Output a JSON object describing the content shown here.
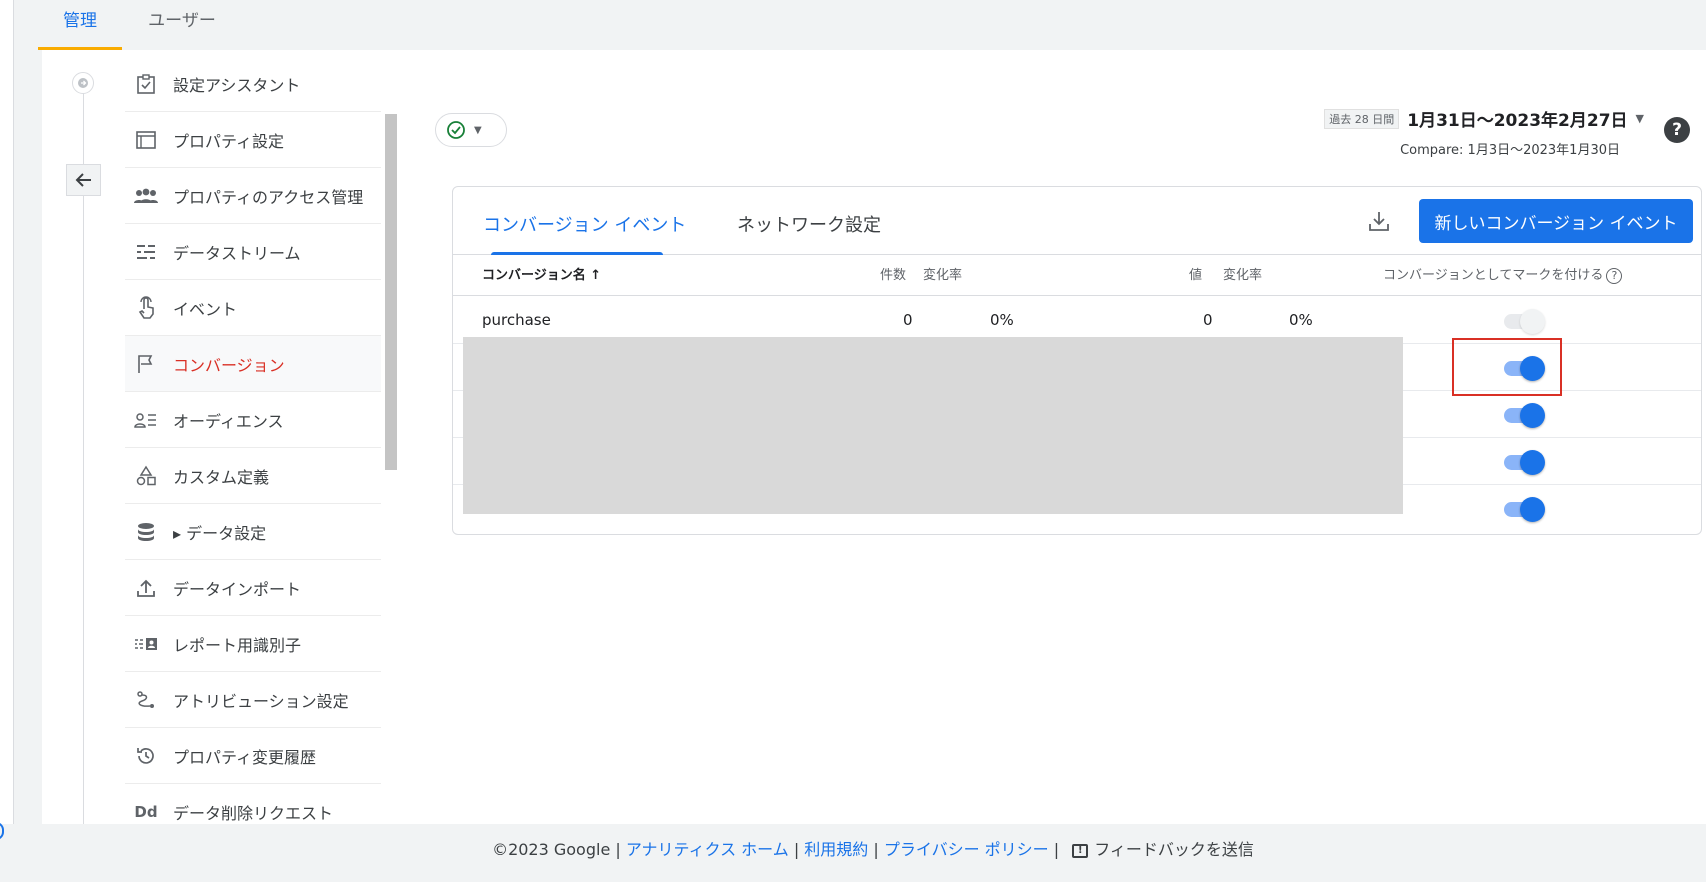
{
  "top_tabs": {
    "admin": "管理",
    "user": "ユーザー"
  },
  "sidebar": {
    "setup_assistant": "設定アシスタント",
    "items": [
      {
        "label": "プロパティ設定",
        "icon": "layout-icon"
      },
      {
        "label": "プロパティのアクセス管理",
        "icon": "people-icon"
      },
      {
        "label": "データストリーム",
        "icon": "streams-icon"
      },
      {
        "label": "イベント",
        "icon": "touch-icon"
      },
      {
        "label": "コンバージョン",
        "icon": "flag-icon",
        "active": true
      },
      {
        "label": "オーディエンス",
        "icon": "audience-icon"
      },
      {
        "label": "カスタム定義",
        "icon": "shapes-icon"
      },
      {
        "label": "▸ データ設定",
        "icon": "database-icon"
      },
      {
        "label": "データインポート",
        "icon": "upload-icon"
      },
      {
        "label": "レポート用識別子",
        "icon": "identity-icon"
      },
      {
        "label": "アトリビューション設定",
        "icon": "attribution-icon"
      },
      {
        "label": "プロパティ変更履歴",
        "icon": "history-icon"
      },
      {
        "label": "データ削除リクエスト",
        "icon": "dd-icon"
      }
    ]
  },
  "date": {
    "badge": "過去 28 日間",
    "range": "1月31日～2023年2月27日",
    "compare": "Compare: 1月3日～2023年1月30日"
  },
  "card": {
    "tabs": {
      "conversion_events": "コンバージョン イベント",
      "network_settings": "ネットワーク設定"
    },
    "new_button": "新しいコンバージョン イベント",
    "headers": {
      "name": "コンバージョン名 ↑",
      "count": "件数",
      "change1": "変化率",
      "value": "値",
      "change2": "変化率",
      "mark": "コンバージョンとしてマークを付ける"
    },
    "rows": [
      {
        "name": "purchase",
        "count": "0",
        "change1": "0%",
        "value": "0",
        "change2": "0%",
        "toggle_on": false
      },
      {
        "toggle_on": true
      },
      {
        "toggle_on": true
      },
      {
        "toggle_on": true
      },
      {
        "toggle_on": true
      }
    ]
  },
  "footer": {
    "copyright": "©2023 Google |",
    "home": "アナリティクス ホーム",
    "sep1": "|",
    "terms": "利用規約",
    "sep2": "|",
    "privacy": "プライバシー ポリシー",
    "sep3": "|",
    "feedback": "フィードバックを送信"
  },
  "colors": {
    "accent": "#1a73e8",
    "active_nav": "#d93025",
    "tab_underline": "#f9ab00"
  }
}
